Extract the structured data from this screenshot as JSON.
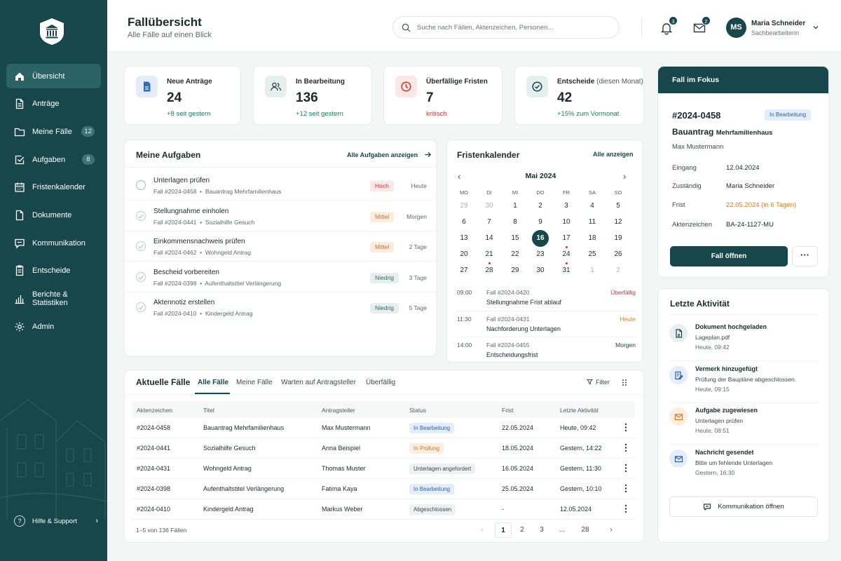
{
  "sidebar": {
    "items": [
      {
        "label": "Übersicht"
      },
      {
        "label": "Anträge"
      },
      {
        "label": "Meine Fälle",
        "badge": "12"
      },
      {
        "label": "Aufgaben",
        "badge": "8"
      },
      {
        "label": "Fristenkalender"
      },
      {
        "label": "Dokumente"
      },
      {
        "label": "Kommunikation"
      },
      {
        "label": "Entscheide"
      },
      {
        "label": "Berichte & Statistiken"
      },
      {
        "label": "Admin"
      }
    ],
    "help_label": "Hilfe & Support"
  },
  "header": {
    "title": "Fallübersicht",
    "subtitle": "Alle Fälle auf einen Blick",
    "search_placeholder": "Suche nach Fällen, Aktenzeichen, Personen...",
    "notifications_count": "3",
    "messages_count": "2",
    "user": {
      "initials": "MS",
      "name": "Maria Schneider",
      "role": "Sachbearbeiterin"
    }
  },
  "stats": [
    {
      "label": "Neue Anträge",
      "value": "24",
      "change": "+8 seit gestern"
    },
    {
      "label": "In Bearbeitung",
      "value": "136",
      "change": "+12 seit gestern"
    },
    {
      "label": "Überfällige Fristen",
      "value": "7",
      "change": "kritisch"
    },
    {
      "label": "Entscheide",
      "label_sub": "(diesen Monat)",
      "value": "42",
      "change": "+15% zum Vormonat"
    }
  ],
  "tasks": {
    "title": "Meine Aufgaben",
    "link": "Alle Aufgaben anzeigen",
    "items": [
      {
        "title": "Unterlagen prüfen",
        "case": "Fall #2024-0458",
        "type": "Bauantrag Mehrfamilienhaus",
        "priority": "Hoch",
        "due": "Heute"
      },
      {
        "title": "Stellungnahme einholen",
        "case": "Fall #2024-0441",
        "type": "Sozialhilfe Gesuch",
        "priority": "Mittel",
        "due": "Morgen"
      },
      {
        "title": "Einkommensnachweis prüfen",
        "case": "Fall #2024-0462",
        "type": "Wohngeld Antrag",
        "priority": "Mittel",
        "due": "2 Tage"
      },
      {
        "title": "Bescheid vorbereiten",
        "case": "Fall #2024-0398",
        "type": "Aufenthaltstitel Verlängerung",
        "priority": "Niedrig",
        "due": "3 Tage"
      },
      {
        "title": "Aktennotiz erstellen",
        "case": "Fall #2024-0410",
        "type": "Kindergeld Antrag",
        "priority": "Niedrig",
        "due": "5 Tage"
      }
    ]
  },
  "calendar": {
    "title": "Fristenkalender",
    "link": "Alle anzeigen",
    "month": "Mai 2024",
    "weekdays": [
      "MO",
      "DI",
      "MI",
      "DO",
      "FR",
      "SA",
      "SO"
    ],
    "weeks": [
      [
        "29",
        "30",
        "1",
        "2",
        "3",
        "4",
        "5"
      ],
      [
        "6",
        "7",
        "8",
        "9",
        "10",
        "11",
        "12"
      ],
      [
        "13",
        "14",
        "15",
        "16",
        "17",
        "18",
        "19"
      ],
      [
        "20",
        "21",
        "22",
        "23",
        "24",
        "25",
        "26"
      ],
      [
        "27",
        "28",
        "29",
        "30",
        "31",
        "1",
        "2"
      ]
    ],
    "events": [
      {
        "time": "09:00",
        "case": "Fall #2024-0420",
        "desc": "Stellungnahme Frist ablauf",
        "status": "Überfällig"
      },
      {
        "time": "11:30",
        "case": "Fall #2024-0431",
        "desc": "Nachforderung Unterlagen",
        "status": "Heute"
      },
      {
        "time": "14:00",
        "case": "Fall #2024-0455",
        "desc": "Entscheidungsfrist",
        "status": "Morgen"
      }
    ]
  },
  "cases": {
    "title": "Aktuelle Fälle",
    "tabs": [
      "Alle Fälle",
      "Meine Fälle",
      "Warten auf Antragsteller",
      "Überfällig"
    ],
    "filter_label": "Filter",
    "columns": [
      "Aktenzeichen",
      "Titel",
      "Antragsteller",
      "Status",
      "Frist",
      "Letzte Aktivität"
    ],
    "rows": [
      {
        "id": "#2024-0458",
        "title": "Bauantrag Mehrfamilienhaus",
        "applicant": "Max Mustermann",
        "status": "In Bearbeitung",
        "deadline": "22.05.2024",
        "activity": "Heute, 09:42"
      },
      {
        "id": "#2024-0441",
        "title": "Sozialhilfe Gesuch",
        "applicant": "Anna Beispiel",
        "status": "In Prüfung",
        "deadline": "18.05.2024",
        "activity": "Gestern, 14:22"
      },
      {
        "id": "#2024-0431",
        "title": "Wohngeld Antrag",
        "applicant": "Thomas Muster",
        "status": "Unterlagen angefordert",
        "deadline": "16.05.2024",
        "activity": "Gestern, 11:30"
      },
      {
        "id": "#2024-0398",
        "title": "Aufenthaltstitel Verlängerung",
        "applicant": "Fatima Kaya",
        "status": "In Bearbeitung",
        "deadline": "25.05.2024",
        "activity": "Gestern, 10:10"
      },
      {
        "id": "#2024-0410",
        "title": "Kindergeld Antrag",
        "applicant": "Markus Weber",
        "status": "Abgeschlossen",
        "deadline": "-",
        "activity": "12.05.2024"
      }
    ],
    "pager_info": "1–5 von 136 Fällen",
    "pages": [
      "1",
      "2",
      "3",
      "...",
      "28"
    ]
  },
  "focus": {
    "title": "Fall im Fokus",
    "case_id": "#2024-0458",
    "status": "In Bearbeitung",
    "case_title": "Bauantrag",
    "case_title_sub": "Mehrfamilienhaus",
    "person": "Max Mustermann",
    "fields": [
      {
        "key": "Eingang",
        "value": "12.04.2024"
      },
      {
        "key": "Zuständig",
        "value": "Maria Schneider"
      },
      {
        "key": "Frist",
        "value": "22.05.2024 (in 6 Tagen)"
      },
      {
        "key": "Aktenzeichen",
        "value": "BA-24-1127-MU"
      }
    ],
    "open_label": "Fall öffnen",
    "more_label": "···"
  },
  "activity": {
    "title": "Letzte Aktivität",
    "items": [
      {
        "title": "Dokument hochgeladen",
        "detail": "Lageplan.pdf",
        "time": "Heute, 09:42"
      },
      {
        "title": "Vermerk hinzugefügt",
        "detail": "Prüfung der Baupläne abgeschlossen.",
        "time": "Heute, 09:15"
      },
      {
        "title": "Aufgabe zugewiesen",
        "detail": "Unterlagen prüfen",
        "time": "Heute, 08:51"
      },
      {
        "title": "Nachricht gesendet",
        "detail": "Bitte um fehlende Unterlagen",
        "time": "Gestern, 16:30"
      }
    ],
    "button_label": "Kommunikation öffnen"
  },
  "colors": {
    "primary": "#17474a",
    "success": "#1e7a58",
    "danger": "#c6382e",
    "warning": "#dd7a1f",
    "info": "#2f5f9e"
  }
}
